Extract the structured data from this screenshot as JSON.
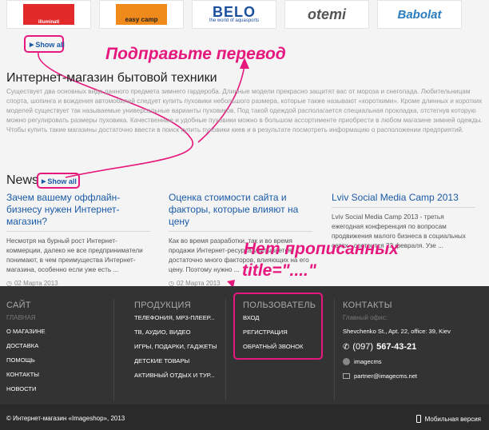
{
  "brands": [
    "illuminati",
    "easy camp",
    "BELO",
    "the world of aquasports",
    "otemi",
    "Babolat"
  ],
  "show_all": "Show all",
  "annotations": {
    "translate": "Подправьте перевод",
    "no_title_line1": "Нет прописанных",
    "no_title_line2": "title=\"....\""
  },
  "store": {
    "heading": "Интернет-магазин бытовой техники",
    "intro": "Существует два основных вида данного предмета зимнего гардероба. Длинные модели прекрасно защитят вас от мороза и снегопада. Любительницам спорта, шопинга и вождения автомобилей следует купить пуховики небольшого размера, которые также называют «короткими». Кроме длинных и коротких моделей существует так называемые универсальные варианты пуховиков. Под такой одеждой располагается специальная прокладка, отстегнув которую можно регулировать размеры пуховика. Качественные и удобные пуховики можно в большом ассортименте приобрести в любом магазине зимней одежды. Чтобы купить такие магазины достаточно ввести в поиск купить пуховики киев и в результате посмотреть информацию о расположении предприятий."
  },
  "news": {
    "heading": "News",
    "items": [
      {
        "title": "Зачем вашему оффлайн-бизнесу нужен Интернет-магазин?",
        "text": "Несмотря на бурный рост Интернет-коммерции, далеко не все предприниматели понимают, в чем преимущества Интернет-магазина, особенно если уже есть ...",
        "date": "02 Марта 2013"
      },
      {
        "title": "Оценка стоимости сайта и факторы, которые влияют на цену",
        "text": "Как во время разработки, так и во время продажи Интернет-ресурса учитывается достаточно много факторов, влияющих на его цену. Поэтому нужно ...",
        "date": "02 Марта 2013"
      },
      {
        "title": "Lviv Social Media Camp 2013",
        "text": "Lviv Social Media Camp 2013 - третья ежегодная конференция по вопросам продвижения малого бизнеса в социальных сетях - состоится 23 февраля. Узе ...",
        "date": ""
      }
    ]
  },
  "footer": {
    "site": {
      "heading": "САЙТ",
      "sub": "ГЛАВНАЯ",
      "links": [
        "О МАГАЗИНЕ",
        "ДОСТАВКА",
        "ПОМОЩЬ",
        "КОНТАКТЫ",
        "НОВОСТИ"
      ]
    },
    "products": {
      "heading": "ПРОДУКЦИЯ",
      "links": [
        "ТЕЛЕФОНИЯ, МР3-ПЛЕЕР...",
        "ТВ, АУДИО, ВИДЕО",
        "ИГРЫ, ПОДАРКИ, ГАДЖЕТЫ",
        "ДЕТСКИЕ ТОВАРЫ",
        "АКТИВНЫЙ ОТДЫХ И ТУР..."
      ]
    },
    "user": {
      "heading": "ПОЛЬЗОВАТЕЛЬ",
      "links": [
        "ВХОД",
        "РЕГИСТРАЦИЯ",
        "ОБРАТНЫЙ ЗВОНОК"
      ]
    },
    "contacts": {
      "heading": "КОНТАКТЫ",
      "sub": "Главный офис:",
      "address": "Shevchenko St., Apt. 22, office: 39, Kiev",
      "phone_code": "(097)",
      "phone_number": "567-43-21",
      "skype": "imagecms",
      "email": "partner@imagecms.net"
    },
    "copyright": "© Интернет-магазин «Imageshop», 2013",
    "mobile": "Мобильная версия"
  },
  "colors": {
    "accent": "#e6177d",
    "link": "#1a5aa8",
    "footer": "#333333"
  }
}
